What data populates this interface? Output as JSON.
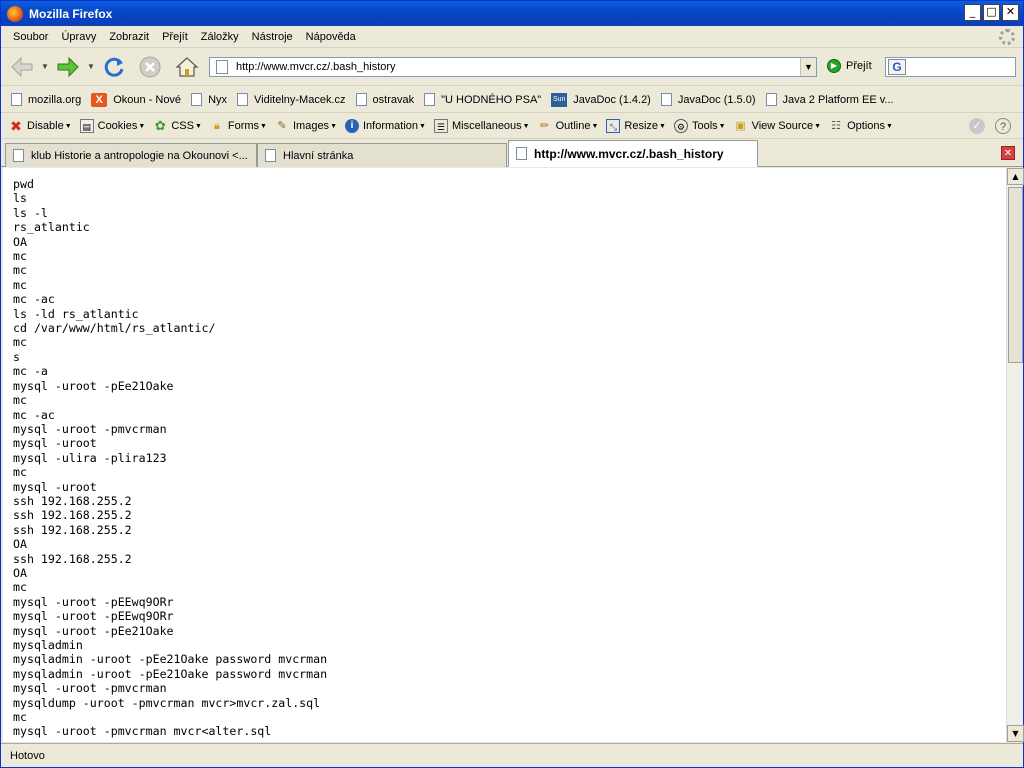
{
  "window": {
    "title": "Mozilla Firefox"
  },
  "menu": [
    "Soubor",
    "Úpravy",
    "Zobrazit",
    "Přejít",
    "Záložky",
    "Nástroje",
    "Nápověda"
  ],
  "nav": {
    "url": "http://www.mvcr.cz/.bash_history",
    "go_label": "Přejít",
    "search_value": ""
  },
  "bookmarks": [
    {
      "label": "mozilla.org",
      "icon": "page-icon"
    },
    {
      "label": "Okoun - Nové",
      "icon": "okoun-icon"
    },
    {
      "label": "Nyx",
      "icon": "page-icon"
    },
    {
      "label": "Viditelny-Macek.cz",
      "icon": "page-icon"
    },
    {
      "label": "ostravak",
      "icon": "page-icon"
    },
    {
      "label": "\"U HODNÉHO PSA\"",
      "icon": "page-icon"
    },
    {
      "label": "JavaDoc (1.4.2)",
      "icon": "sun-icon"
    },
    {
      "label": "JavaDoc (1.5.0)",
      "icon": "page-icon"
    },
    {
      "label": "Java 2 Platform EE v...",
      "icon": "page-icon"
    }
  ],
  "devtools": [
    {
      "label": "Disable",
      "icon": "x-icon",
      "color": "#d42a1a"
    },
    {
      "label": "Cookies",
      "icon": "cookie-icon",
      "color": "#555555"
    },
    {
      "label": "CSS",
      "icon": "css-icon",
      "color": "#3a9a2a"
    },
    {
      "label": "Forms",
      "icon": "lock-icon",
      "color": "#c9a020"
    },
    {
      "label": "Images",
      "icon": "images-icon",
      "color": "#886633"
    },
    {
      "label": "Information",
      "icon": "info-icon",
      "color": "#2c5fb8"
    },
    {
      "label": "Miscellaneous",
      "icon": "misc-icon",
      "color": "#555555"
    },
    {
      "label": "Outline",
      "icon": "pencil-icon",
      "color": "#b07020"
    },
    {
      "label": "Resize",
      "icon": "resize-icon",
      "color": "#2c5fb8"
    },
    {
      "label": "Tools",
      "icon": "tools-icon",
      "color": "#555555"
    },
    {
      "label": "View Source",
      "icon": "source-icon",
      "color": "#c9a020"
    },
    {
      "label": "Options",
      "icon": "options-icon",
      "color": "#555555"
    }
  ],
  "tabs": [
    {
      "label": "klub Historie a antropologie na Okounovi <...",
      "active": false
    },
    {
      "label": "Hlavní stránka",
      "active": false
    },
    {
      "label": "http://www.mvcr.cz/.bash_history",
      "active": true
    }
  ],
  "content": {
    "lines": [
      "pwd",
      "ls",
      "ls -l",
      "rs_atlantic",
      "OA",
      "mc",
      "mc",
      "mc",
      "mc -ac",
      "ls -ld rs_atlantic",
      "cd /var/www/html/rs_atlantic/",
      "mc",
      "s",
      "mc -a",
      "mysql -uroot -pEe21Oake",
      "mc",
      "mc -ac",
      "mysql -uroot -pmvcrman",
      "mysql -uroot",
      "mysql -ulira -plira123",
      "mc",
      "mysql -uroot",
      "ssh 192.168.255.2",
      "ssh 192.168.255.2",
      "ssh 192.168.255.2",
      "OA",
      "ssh 192.168.255.2",
      "OA",
      "mc",
      "mysql -uroot -pEEwq9ORr",
      "mysql -uroot -pEEwq9ORr",
      "mysql -uroot -pEe21Oake",
      "mysqladmin",
      "mysqladmin -uroot -pEe21Oake password mvcrman",
      "mysqladmin -uroot -pEe21Oake password mvcrman",
      "mysql -uroot -pmvcrman",
      "mysqldump -uroot -pmvcrman mvcr>mvcr.zal.sql",
      "mc",
      "mysql -uroot -pmvcrman mvcr<alter.sql"
    ]
  },
  "status": {
    "text": "Hotovo"
  }
}
